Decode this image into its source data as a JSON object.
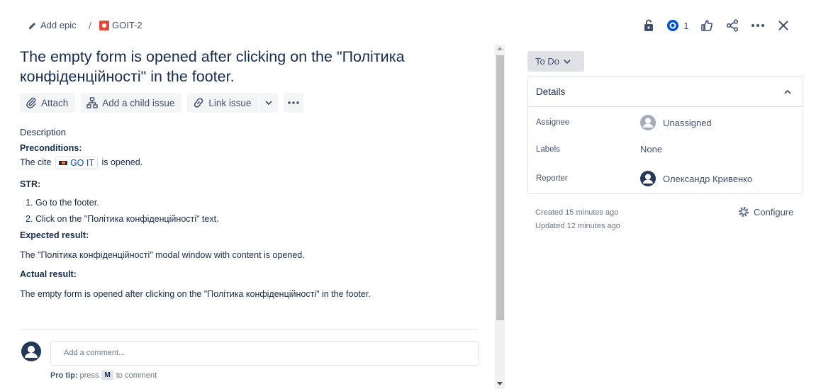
{
  "breadcrumb": {
    "epic_label": "Add epic",
    "separator": "/",
    "issue_key": "GOIT-2"
  },
  "top_actions": {
    "watch_count": "1"
  },
  "issue": {
    "title": "The empty form is opened after clicking on the \"Політика конфіденційності\" in the footer."
  },
  "toolbar": {
    "attach": "Attach",
    "add_child": "Add a child issue",
    "link_issue": "Link issue"
  },
  "description": {
    "label": "Description",
    "preconditions_heading": "Preconditions:",
    "preconditions_prefix": "The cite",
    "link_text": "GO IT",
    "preconditions_suffix": "is opened.",
    "str_heading": "STR:",
    "steps": [
      "Go to the footer.",
      "Click on the \"Політика конфіденційності\" text."
    ],
    "expected_heading": "Expected result:",
    "expected_text": "The \"Політика конфіденційності\" modal window with content is opened.",
    "actual_heading": "Actual result:",
    "actual_text": "The empty form is opened after clicking on the \"Політика конфіденційності\" in the footer."
  },
  "comment": {
    "placeholder": "Add a comment...",
    "protip_label": "Pro tip:",
    "protip_press": "press",
    "protip_key": "M",
    "protip_suffix": "to comment"
  },
  "status": {
    "label": "To Do"
  },
  "details": {
    "heading": "Details",
    "assignee_label": "Assignee",
    "assignee_value": "Unassigned",
    "labels_label": "Labels",
    "labels_value": "None",
    "reporter_label": "Reporter",
    "reporter_value": "Олександр Кривенко"
  },
  "meta": {
    "created": "Created 15 minutes ago",
    "updated": "Updated 12 minutes ago",
    "configure": "Configure"
  },
  "colors": {
    "text_primary": "#172b4d",
    "text_secondary": "#42526e",
    "watch_icon": "#0052cc",
    "bug_icon": "#e5493a",
    "button_bg": "#f4f5f7",
    "status_bg": "#dfe1e6"
  }
}
